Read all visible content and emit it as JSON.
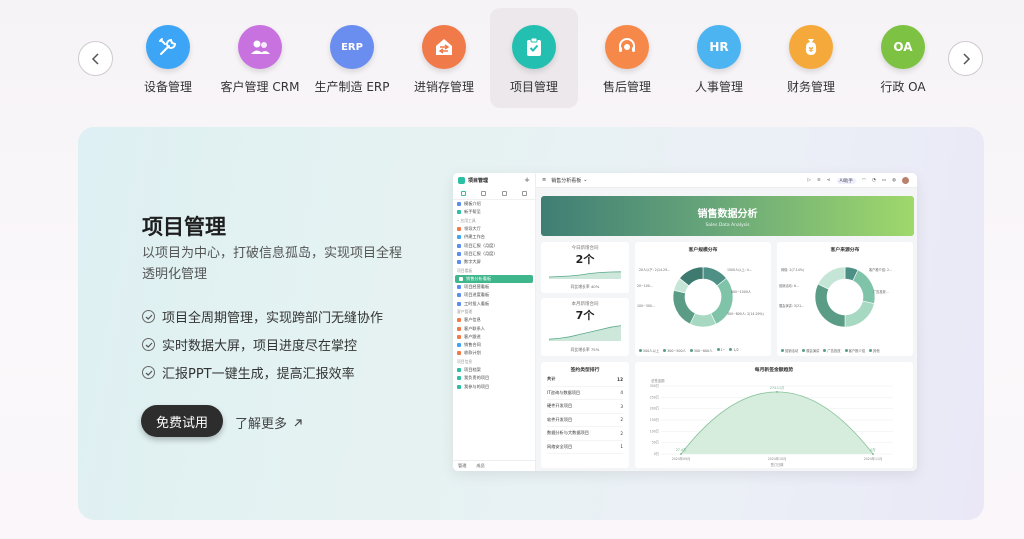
{
  "tabs": [
    {
      "label": "设备管理",
      "icon": "tools-icon",
      "color": "#3da5f6"
    },
    {
      "label": "客户管理 CRM",
      "icon": "users-icon",
      "color": "#c872e0"
    },
    {
      "label": "生产制造 ERP",
      "icon": "erp-icon",
      "text": "ERP",
      "color": "#6a8df0"
    },
    {
      "label": "进销存管理",
      "icon": "house-exchange-icon",
      "color": "#f07a4a"
    },
    {
      "label": "项目管理",
      "icon": "clipboard-check-icon",
      "color": "#23c0b2",
      "active": true
    },
    {
      "label": "售后管理",
      "icon": "headset-icon",
      "color": "#f6894a"
    },
    {
      "label": "人事管理",
      "icon": "hr-icon",
      "text": "HR",
      "color": "#4cb4f0"
    },
    {
      "label": "财务管理",
      "icon": "money-bag-icon",
      "color": "#f5a93a"
    },
    {
      "label": "行政 OA",
      "icon": "oa-icon",
      "text": "OA",
      "color": "#7dc242"
    }
  ],
  "hero": {
    "title": "项目管理",
    "description": "以项目为中心，打破信息孤岛，实现项目全程透明化管理",
    "features": [
      "项目全周期管理，实现跨部门无缝协作",
      "实时数据大屏，项目进度尽在掌控",
      "汇报PPT一键生成，提高汇报效率"
    ],
    "try_button": "免费试用",
    "learn_more": "了解更多"
  },
  "app": {
    "sidebar_title": "项目管理",
    "sidebar_items": [
      {
        "label": "模板介绍",
        "color": "#5b8df0"
      },
      {
        "label": "新手帮至",
        "color": "#2bbfa6"
      },
      {
        "label": "• 应用工具",
        "section": true
      },
      {
        "label": "领导大厅",
        "color": "#f07a4a"
      },
      {
        "label": "供建工作台",
        "color": "#3da5f6"
      },
      {
        "label": "项目汇报（月度）",
        "color": "#5b8df0"
      },
      {
        "label": "项目汇报（月度）",
        "color": "#5b8df0"
      },
      {
        "label": "数字大屏",
        "color": "#5b8df0"
      },
      {
        "label": "项目看板",
        "section": true
      },
      {
        "label": "销售分析看板",
        "active": true
      },
      {
        "label": "项目经营看板",
        "color": "#5b8df0"
      },
      {
        "label": "项目进度看板",
        "color": "#5b8df0"
      },
      {
        "label": "工时投入看板",
        "color": "#5b8df0"
      },
      {
        "label": "客户管理",
        "section": true
      },
      {
        "label": "客户信息",
        "color": "#f07a4a"
      },
      {
        "label": "客户联系人",
        "color": "#f07a4a"
      },
      {
        "label": "客户跟进",
        "color": "#f07a4a"
      },
      {
        "label": "销售合同",
        "color": "#3da5f6"
      },
      {
        "label": "收款计划",
        "color": "#f07a4a"
      },
      {
        "label": "项目信息",
        "section": true
      },
      {
        "label": "项目档案",
        "color": "#2bbfa6"
      },
      {
        "label": "我负责的项目",
        "color": "#2bbfa6"
      },
      {
        "label": "我参与的项目",
        "color": "#2bbfa6"
      }
    ],
    "sidebar_footer": [
      "管理",
      "成员"
    ],
    "topbar_title": "销售分析看板",
    "ai_label": "AI助手",
    "banner_title": "销售数据分析",
    "banner_subtitle": "Sales Data Analysis",
    "kpi": [
      {
        "title": "今日新增合同",
        "value": "2个",
        "rate": "同比增长率 40%",
        "trend": [
          0.1,
          0.15,
          0.2,
          0.3,
          0.45,
          0.55,
          0.6,
          0.62
        ]
      },
      {
        "title": "本月新增合同",
        "value": "7个",
        "rate": "同比增长率 75%",
        "trend": [
          0.05,
          0.1,
          0.2,
          0.35,
          0.5,
          0.65,
          0.8,
          0.9
        ]
      }
    ],
    "pie1": {
      "title": "客户规模分布",
      "legend": [
        "500人以上",
        "300~500人",
        "300~800人",
        "1~",
        "1/2"
      ],
      "labels": [
        "20人以下: 2(14.29...",
        "1500人以上: 4...",
        "20~100...",
        "800~1500人",
        "100~300...",
        "300~800人: 2(14.29%)"
      ],
      "values": [
        2,
        4,
        2,
        3,
        1,
        2
      ]
    },
    "pie2": {
      "title": "客户来源分布",
      "legend": [
        "促销活动",
        "展会演讲",
        "广告投放",
        "客户推介绍",
        "其他"
      ],
      "labels": [
        "网络: 2(7.14%)",
        "客户推介绍: 2...",
        "促销活动: 6...",
        "广告投放...",
        "展会演讲: 3(21..."
      ],
      "values": [
        2,
        6,
        6,
        9,
        5
      ]
    },
    "ranking": {
      "title": "签约类型排行",
      "header": [
        "共计",
        "12"
      ],
      "rows": [
        [
          "IT咨询与数据项目",
          "4"
        ],
        [
          "硬件开发项目",
          "3"
        ],
        [
          "软件开发项目",
          "2"
        ],
        [
          "数据分析与大数据项目",
          "2"
        ],
        [
          "网络安全项目",
          "1"
        ]
      ]
    },
    "trend": {
      "title": "每月新签金额趋势",
      "ylabel": "总签金额",
      "x": [
        "2024年09月",
        "2024年10月",
        "2024年11月"
      ],
      "yticks": [
        "300万",
        "250万",
        "200万",
        "150万",
        "100万",
        "50万",
        "0万"
      ],
      "values": [
        0,
        2740000.0,
        0
      ],
      "labels": [
        "27.4万",
        "274.11万",
        "0万"
      ],
      "xlabel": "签订日期"
    }
  }
}
